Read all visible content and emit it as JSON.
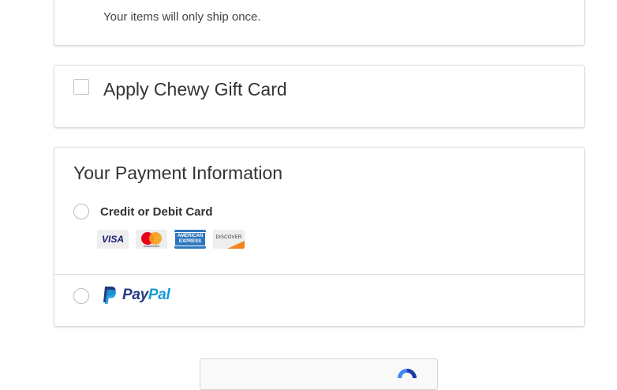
{
  "shipping": {
    "note": "Your items will only ship once."
  },
  "gift_card": {
    "label": "Apply Chewy Gift Card",
    "checked": false
  },
  "payment": {
    "title": "Your Payment Information",
    "options": [
      {
        "label": "Credit or Debit Card",
        "selected": false,
        "card_logos": [
          {
            "name": "visa",
            "text": "VISA"
          },
          {
            "name": "mastercard",
            "text": "mastercard"
          },
          {
            "name": "american-express",
            "text": "AMERICAN EXPRESS"
          },
          {
            "name": "discover",
            "text": "DISCOVER"
          }
        ]
      },
      {
        "label": "PayPal",
        "label_parts": [
          "Pay",
          "Pal"
        ],
        "selected": false
      }
    ]
  },
  "colors": {
    "paypal_dark": "#253b80",
    "paypal_light": "#179bd7",
    "amex_blue": "#2e77bc",
    "panel_border": "#dddddd"
  },
  "icons": [
    "checkbox",
    "radio-button",
    "visa-icon",
    "mastercard-icon",
    "amex-icon",
    "discover-icon",
    "paypal-icon",
    "recaptcha-icon"
  ]
}
